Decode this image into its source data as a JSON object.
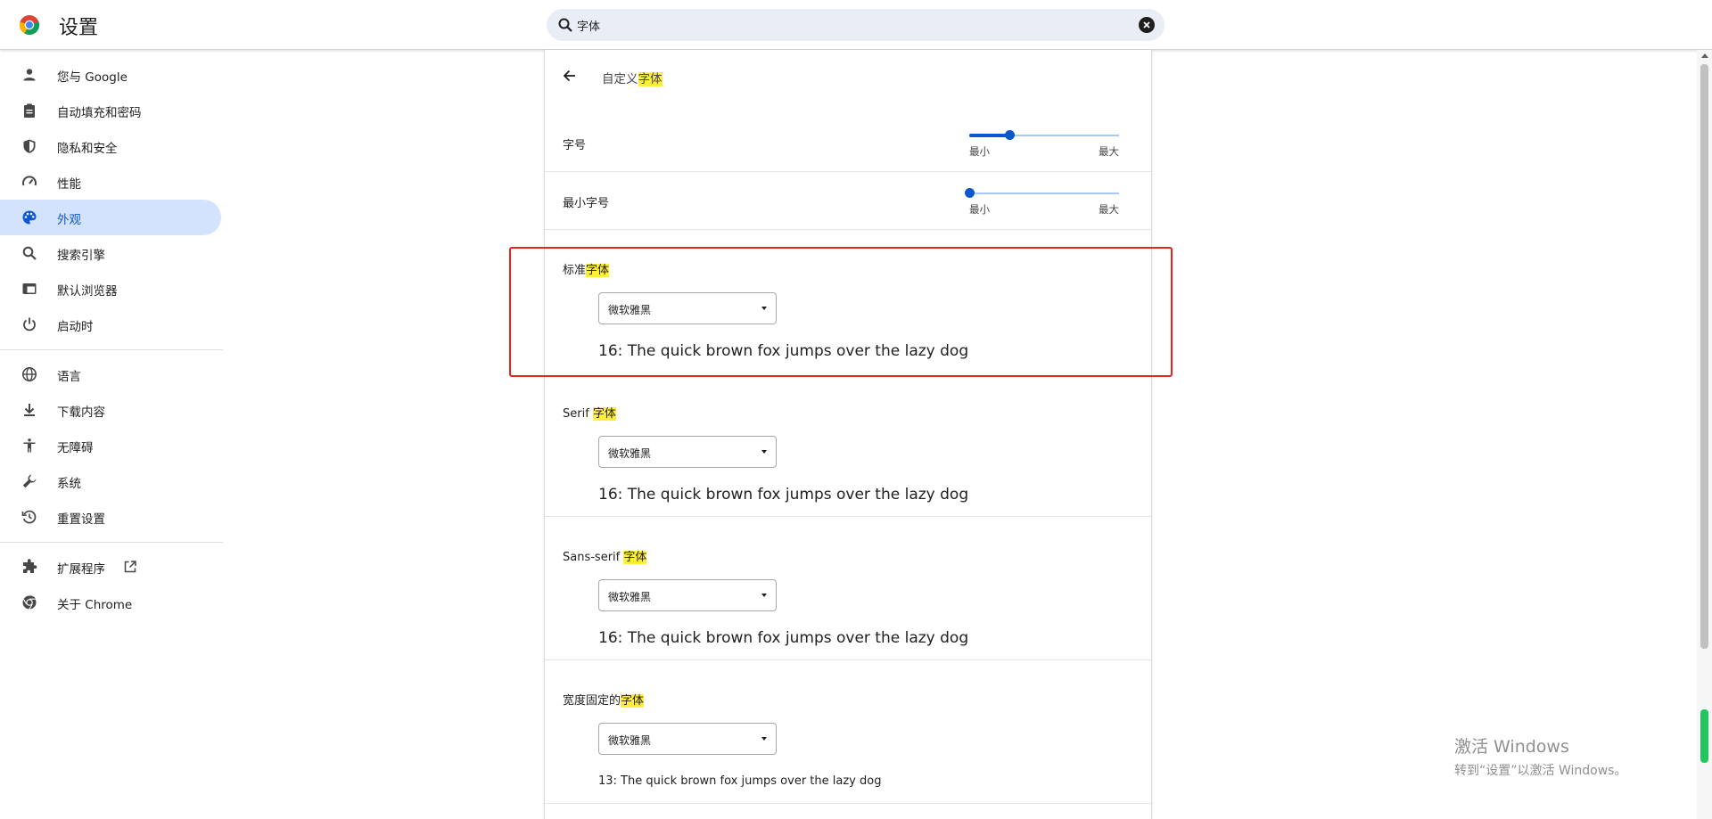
{
  "header": {
    "title": "设置",
    "search": {
      "value": "字体",
      "placeholder": ""
    }
  },
  "sidebar": {
    "items": [
      {
        "label": "您与 Google",
        "icon": "person-icon"
      },
      {
        "label": "自动填充和密码",
        "icon": "clipboard-icon"
      },
      {
        "label": "隐私和安全",
        "icon": "shield-icon"
      },
      {
        "label": "性能",
        "icon": "gauge-icon"
      },
      {
        "label": "外观",
        "icon": "palette-icon",
        "active": true
      },
      {
        "label": "搜索引擎",
        "icon": "search-icon"
      },
      {
        "label": "默认浏览器",
        "icon": "browser-icon"
      },
      {
        "label": "启动时",
        "icon": "power-icon"
      },
      {
        "label": "语言",
        "icon": "globe-icon"
      },
      {
        "label": "下载内容",
        "icon": "download-icon"
      },
      {
        "label": "无障碍",
        "icon": "accessibility-icon"
      },
      {
        "label": "系统",
        "icon": "wrench-icon"
      },
      {
        "label": "重置设置",
        "icon": "reset-icon"
      },
      {
        "label": "扩展程序",
        "icon": "puzzle-icon"
      },
      {
        "label": "关于 Chrome",
        "icon": "chrome-icon"
      }
    ]
  },
  "page": {
    "subtitle_prefix": "自定义",
    "subtitle_hl": "字体",
    "font_size": {
      "label": "字号",
      "min": "最小",
      "max": "最大",
      "value": 0.27
    },
    "min_font_size": {
      "label": "最小字号",
      "min": "最小",
      "max": "最大",
      "value": 0.0
    },
    "standard": {
      "prefix": "标准",
      "hl": "字体",
      "value": "微软雅黑",
      "sample": "16: The quick brown fox jumps over the lazy dog"
    },
    "serif": {
      "prefix": "Serif ",
      "hl": "字体",
      "value": "微软雅黑",
      "sample": "16: The quick brown fox jumps over the lazy dog"
    },
    "sans": {
      "prefix": "Sans-serif ",
      "hl": "字体",
      "value": "微软雅黑",
      "sample": "16: The quick brown fox jumps over the lazy dog"
    },
    "fixed": {
      "prefix": "宽度固定的",
      "hl": "字体",
      "value": "微软雅黑",
      "sample": "13: The quick brown fox jumps over the lazy dog"
    }
  },
  "watermark": {
    "line1": "激活 Windows",
    "line2": "转到“设置”以激活 Windows。"
  },
  "colors": {
    "accent": "#0b57d0",
    "active_bg": "#d3e3fd",
    "highlight": "#ffef3a",
    "annotation": "#e8231a"
  }
}
